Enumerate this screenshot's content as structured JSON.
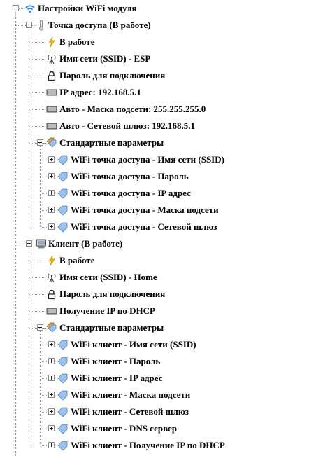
{
  "tree": {
    "rows": [
      {
        "id": "r0",
        "label": "Настройки WiFi модуля",
        "icon": "wifi-icon",
        "level": 0,
        "toggle": "minus"
      },
      {
        "id": "r1",
        "label": "Точка доступа (В работе)",
        "icon": "thermometer-icon",
        "level": 1,
        "toggle": "minus"
      },
      {
        "id": "r2",
        "label": "В работе",
        "icon": "lightning-icon",
        "level": 2,
        "toggle": "none"
      },
      {
        "id": "r3",
        "label": "Имя сети (SSID) - ESP",
        "icon": "antenna-icon",
        "level": 2,
        "toggle": "none"
      },
      {
        "id": "r4",
        "label": "Пароль для подключения",
        "icon": "lock-icon",
        "level": 2,
        "toggle": "none"
      },
      {
        "id": "r5",
        "label": "IP адрес: 192.168.5.1",
        "icon": "memory-icon",
        "level": 2,
        "toggle": "none"
      },
      {
        "id": "r6",
        "label": "Авто - Маска подсети: 255.255.255.0",
        "icon": "memory-icon",
        "level": 2,
        "toggle": "none"
      },
      {
        "id": "r7",
        "label": "Авто - Сетевой шлюз: 192.168.5.1",
        "icon": "memory-icon",
        "level": 2,
        "toggle": "none"
      },
      {
        "id": "r8",
        "label": "Стандартные параметры",
        "icon": "tags-icon",
        "level": 2,
        "toggle": "minus"
      },
      {
        "id": "r9",
        "label": "WiFi точка доступа - Имя сети (SSID)",
        "icon": "tag-icon",
        "level": 3,
        "toggle": "plus"
      },
      {
        "id": "r10",
        "label": "WiFi точка доступа - Пароль",
        "icon": "tag-icon",
        "level": 3,
        "toggle": "plus"
      },
      {
        "id": "r11",
        "label": "WiFi точка доступа - IP адрес",
        "icon": "tag-icon",
        "level": 3,
        "toggle": "plus"
      },
      {
        "id": "r12",
        "label": "WiFi точка доступа - Маска подсети",
        "icon": "tag-icon",
        "level": 3,
        "toggle": "plus"
      },
      {
        "id": "r13",
        "label": "WiFi точка доступа - Сетевой шлюз",
        "icon": "tag-icon",
        "level": 3,
        "toggle": "plus"
      },
      {
        "id": "r14",
        "label": "Клиент (В работе)",
        "icon": "computer-icon",
        "level": 1,
        "toggle": "minus"
      },
      {
        "id": "r15",
        "label": "В работе",
        "icon": "lightning-icon",
        "level": 2,
        "toggle": "none"
      },
      {
        "id": "r16",
        "label": "Имя сети (SSID) - Home",
        "icon": "antenna-icon",
        "level": 2,
        "toggle": "none"
      },
      {
        "id": "r17",
        "label": "Пароль для подключения",
        "icon": "lock-icon",
        "level": 2,
        "toggle": "none"
      },
      {
        "id": "r18",
        "label": "Получение IP по DHCP",
        "icon": "memory-icon",
        "level": 2,
        "toggle": "none"
      },
      {
        "id": "r19",
        "label": "Стандартные параметры",
        "icon": "tags-icon",
        "level": 2,
        "toggle": "minus"
      },
      {
        "id": "r20",
        "label": "WiFi клиент - Имя сети (SSID)",
        "icon": "tag-icon",
        "level": 3,
        "toggle": "plus"
      },
      {
        "id": "r21",
        "label": "WiFi клиент - Пароль",
        "icon": "tag-icon",
        "level": 3,
        "toggle": "plus"
      },
      {
        "id": "r22",
        "label": "WiFi клиент - IP адрес",
        "icon": "tag-icon",
        "level": 3,
        "toggle": "plus"
      },
      {
        "id": "r23",
        "label": "WiFi клиент - Маска подсети",
        "icon": "tag-icon",
        "level": 3,
        "toggle": "plus"
      },
      {
        "id": "r24",
        "label": "WiFi клиент - Сетевой шлюз",
        "icon": "tag-icon",
        "level": 3,
        "toggle": "plus"
      },
      {
        "id": "r25",
        "label": "WiFi клиент - DNS сервер",
        "icon": "tag-icon",
        "level": 3,
        "toggle": "plus"
      },
      {
        "id": "r26",
        "label": "WiFi клиент - Получение IP по DHCP",
        "icon": "tag-icon",
        "level": 3,
        "toggle": "plus"
      }
    ]
  },
  "colors": {
    "tree_line": "#9a9a9a",
    "wifi_blue": "#2f86e6",
    "lightning": "#f2b600",
    "tag_blue": "#8fb8e8",
    "memory_gray": "#7a7a7a"
  }
}
